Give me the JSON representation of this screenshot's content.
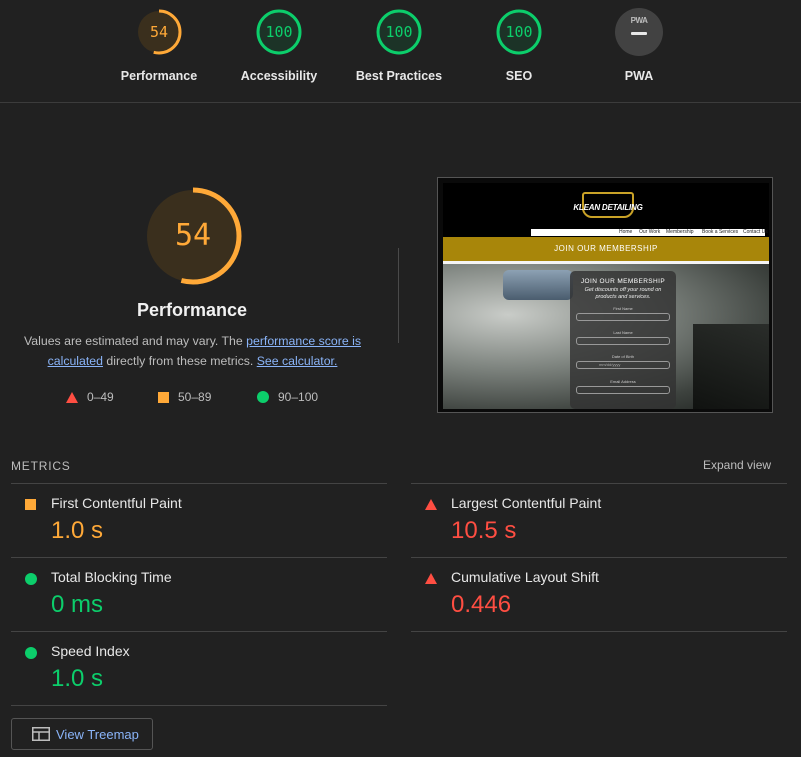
{
  "colors": {
    "average": "#ffa938",
    "pass": "#0cce6b",
    "fail": "#ff4e42",
    "link": "#8ab4f8",
    "background": "#212121"
  },
  "top_scores": [
    {
      "label": "Performance",
      "score": "54",
      "value": 54,
      "rating": "average"
    },
    {
      "label": "Accessibility",
      "score": "100",
      "value": 100,
      "rating": "pass"
    },
    {
      "label": "Best Practices",
      "score": "100",
      "value": 100,
      "rating": "pass"
    },
    {
      "label": "SEO",
      "score": "100",
      "value": 100,
      "rating": "pass"
    },
    {
      "label": "PWA",
      "badge_text": "PWA",
      "rating": "na"
    }
  ],
  "performance": {
    "score": "54",
    "value": 54,
    "title": "Performance",
    "desc_prefix": "Values are estimated and may vary. The ",
    "desc_link1": "performance score is calculated",
    "desc_middle": " directly from these metrics. ",
    "desc_link2": "See calculator."
  },
  "legend": [
    {
      "range": "0–49",
      "icon": "red-triangle-icon"
    },
    {
      "range": "50–89",
      "icon": "orange-square-icon"
    },
    {
      "range": "90–100",
      "icon": "green-circle-icon"
    }
  ],
  "screenshot": {
    "logo_text": "KLEAN DETAILING",
    "nav": [
      "Home",
      "Our Work",
      "Membership",
      "Book a Services",
      "Contact Us"
    ],
    "banner": "JOIN OUR MEMBERSHIP",
    "form_title": "JOIN OUR MEMBERSHIP",
    "form_subtitle": "Get discounts off your round on products and services.",
    "fields": [
      "First Name",
      "Last Name",
      "Date of Birth",
      "Email Address"
    ],
    "date_placeholder": "mm/dd/yyyy"
  },
  "metrics": {
    "title": "METRICS",
    "expand": "Expand view",
    "items": [
      {
        "name": "First Contentful Paint",
        "value": "1.0 s",
        "rating": "average"
      },
      {
        "name": "Largest Contentful Paint",
        "value": "10.5 s",
        "rating": "fail"
      },
      {
        "name": "Total Blocking Time",
        "value": "0 ms",
        "rating": "pass"
      },
      {
        "name": "Cumulative Layout Shift",
        "value": "0.446",
        "rating": "fail"
      },
      {
        "name": "Speed Index",
        "value": "1.0 s",
        "rating": "pass"
      }
    ]
  },
  "treemap": {
    "label": "View Treemap"
  }
}
